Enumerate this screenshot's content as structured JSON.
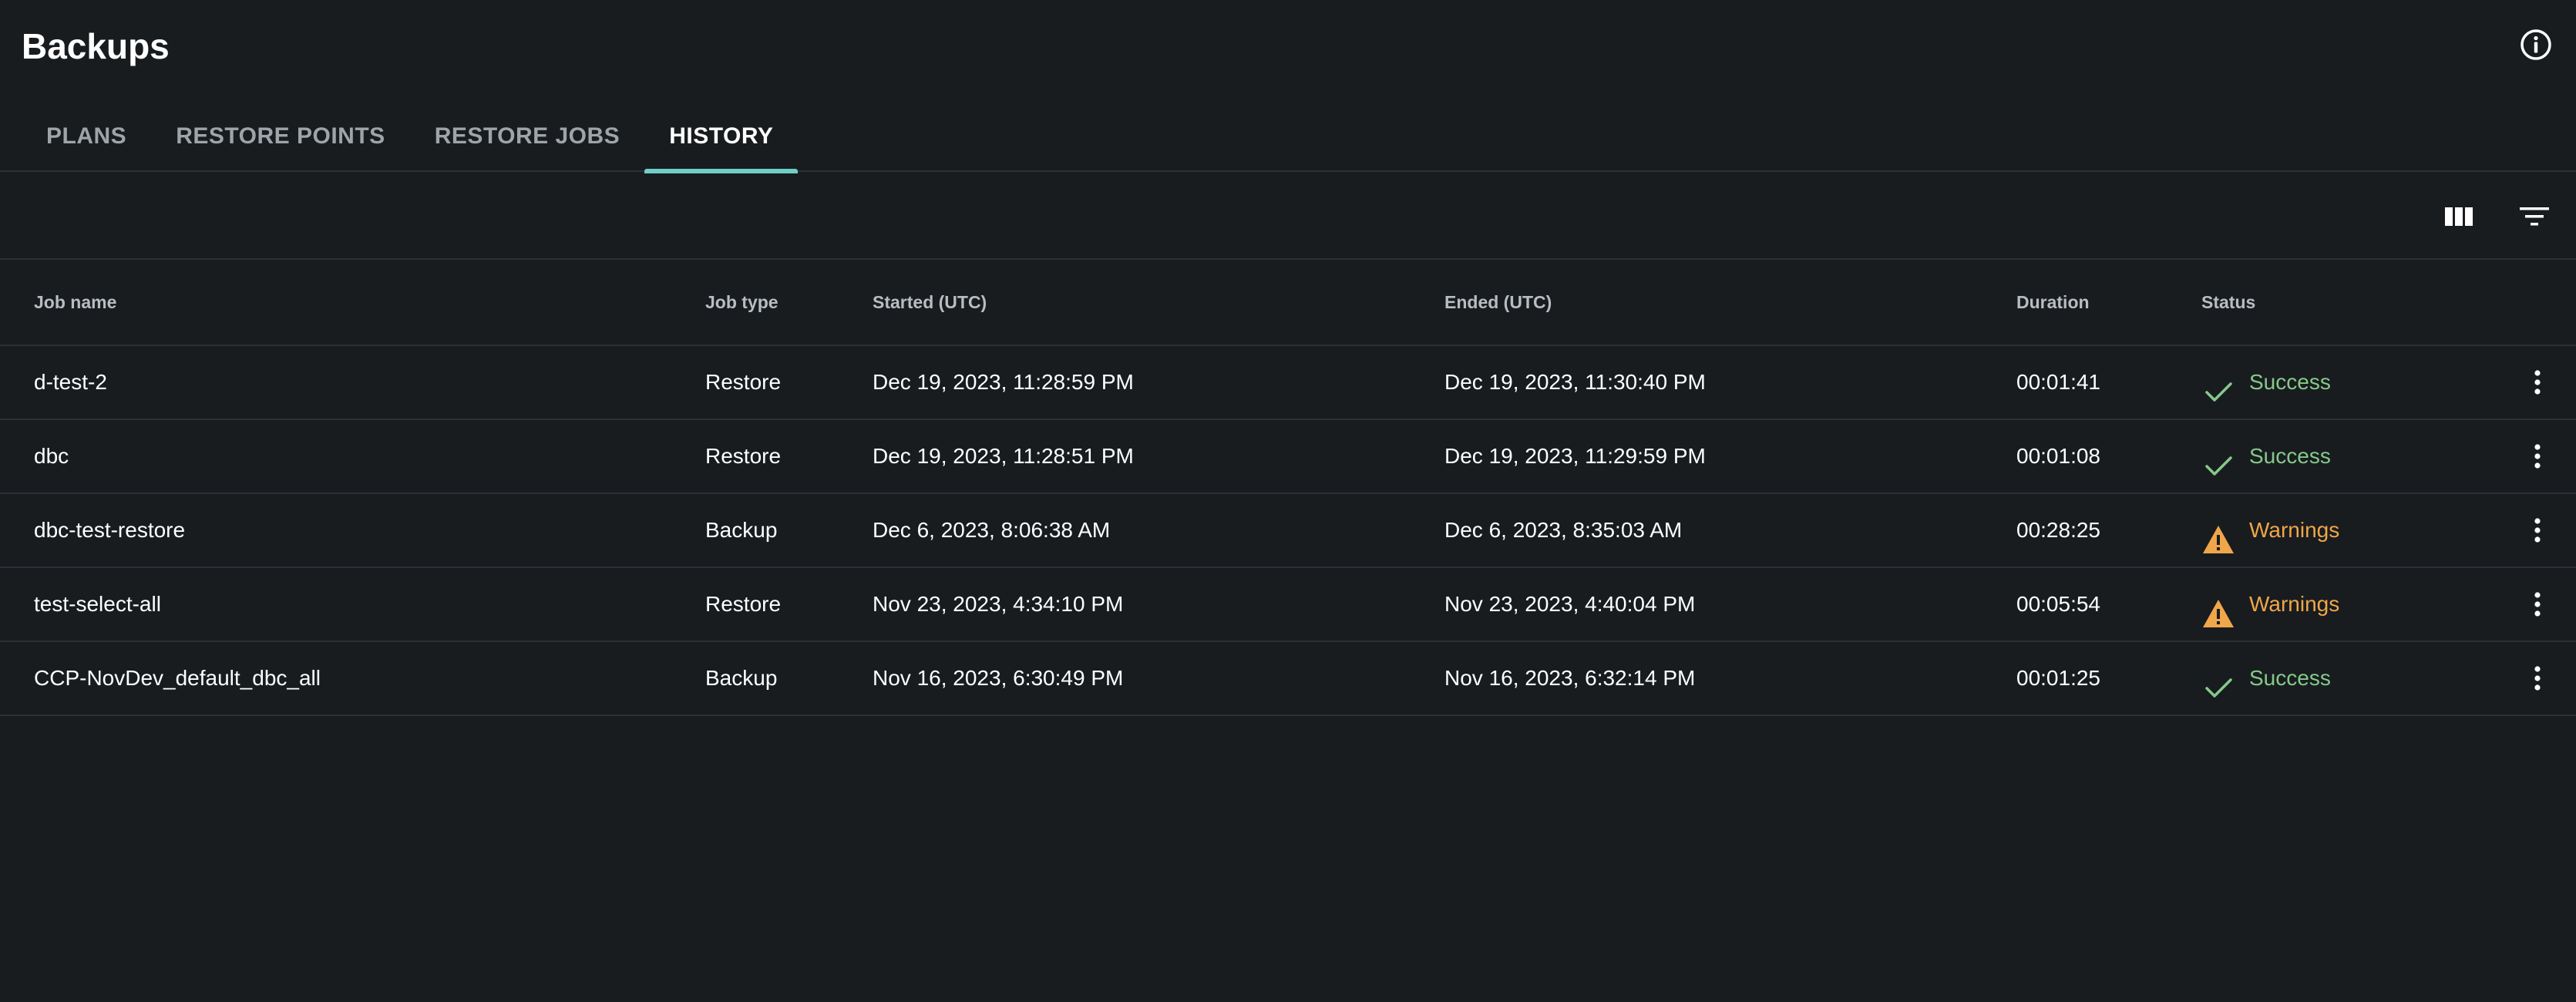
{
  "header": {
    "title": "Backups",
    "info_icon": "info-icon"
  },
  "tabs": [
    {
      "label": "PLANS",
      "active": false
    },
    {
      "label": "RESTORE POINTS",
      "active": false
    },
    {
      "label": "RESTORE JOBS",
      "active": false
    },
    {
      "label": "HISTORY",
      "active": true
    }
  ],
  "toolbar": {
    "columns_icon": "columns-icon",
    "filter_icon": "filter-icon"
  },
  "table": {
    "columns": [
      "Job name",
      "Job type",
      "Started (UTC)",
      "Ended (UTC)",
      "Duration",
      "Status"
    ],
    "rows": [
      {
        "job_name": "d-test-2",
        "job_type": "Restore",
        "started": "Dec 19, 2023, 11:28:59 PM",
        "ended": "Dec 19, 2023, 11:30:40 PM",
        "duration": "00:01:41",
        "status": "Success"
      },
      {
        "job_name": "dbc",
        "job_type": "Restore",
        "started": "Dec 19, 2023, 11:28:51 PM",
        "ended": "Dec 19, 2023, 11:29:59 PM",
        "duration": "00:01:08",
        "status": "Success"
      },
      {
        "job_name": "dbc-test-restore",
        "job_type": "Backup",
        "started": "Dec 6, 2023, 8:06:38 AM",
        "ended": "Dec 6, 2023, 8:35:03 AM",
        "duration": "00:28:25",
        "status": "Warnings"
      },
      {
        "job_name": "test-select-all",
        "job_type": "Restore",
        "started": "Nov 23, 2023, 4:34:10 PM",
        "ended": "Nov 23, 2023, 4:40:04 PM",
        "duration": "00:05:54",
        "status": "Warnings"
      },
      {
        "job_name": "CCP-NovDev_default_dbc_all",
        "job_type": "Backup",
        "started": "Nov 16, 2023, 6:30:49 PM",
        "ended": "Nov 16, 2023, 6:32:14 PM",
        "duration": "00:01:25",
        "status": "Success"
      }
    ]
  },
  "colors": {
    "background": "#181c1f",
    "tab_accent": "#6fcfc6",
    "success": "#86c98a",
    "warning": "#f0a64a"
  }
}
